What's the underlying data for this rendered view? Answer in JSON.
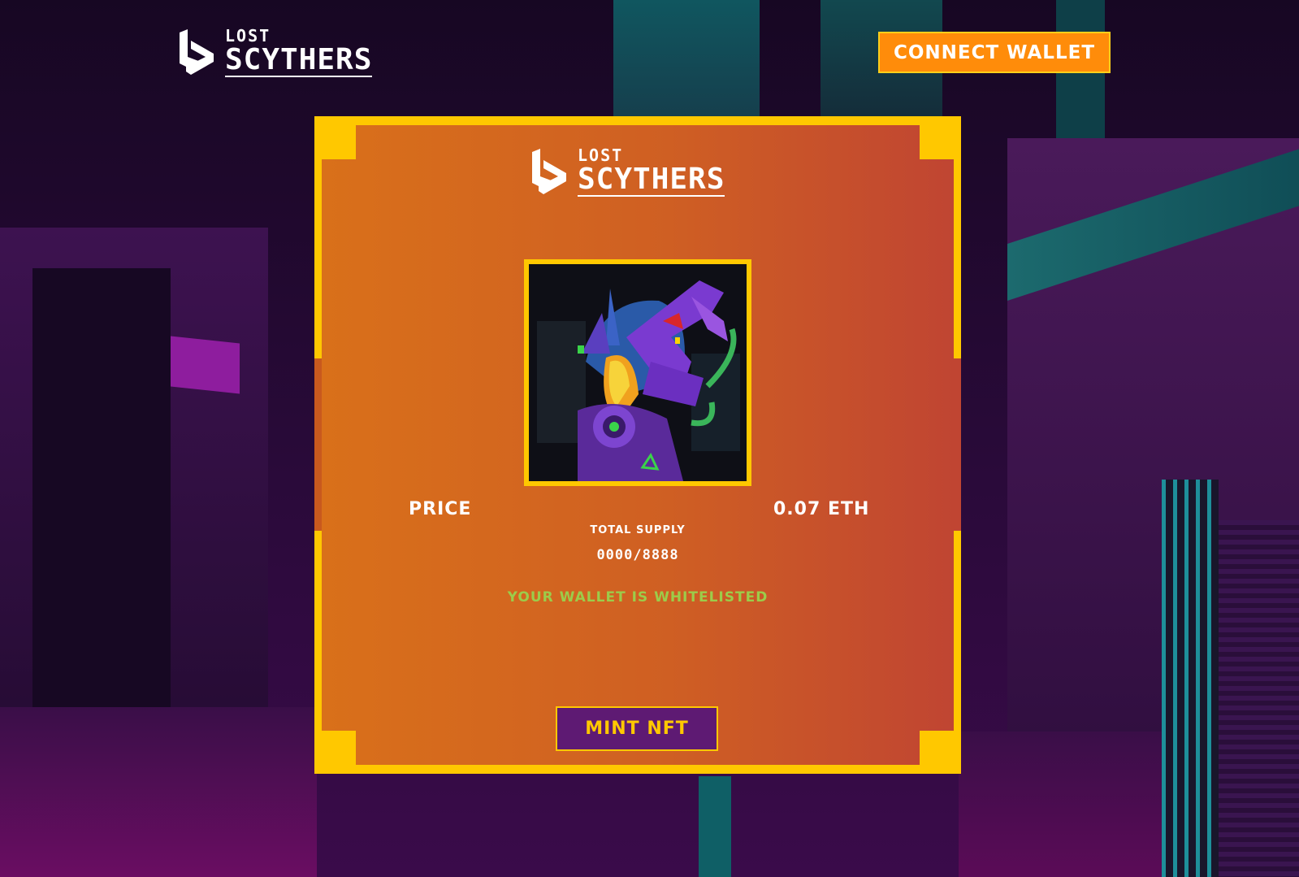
{
  "header": {
    "logo_top": "LOST",
    "logo_bottom": "SCYTHERS",
    "connect_label": "CONNECT WALLET"
  },
  "card": {
    "logo_top": "LOST",
    "logo_bottom": "SCYTHERS",
    "price_label": "PRICE",
    "price_value": "0.07 ETH",
    "supply_label": "TOTAL SUPPLY",
    "supply_value": "0000/8888",
    "whitelist_status": "YOUR WALLET IS WHITELISTED",
    "mint_label": "MINT NFT"
  },
  "colors": {
    "frame": "#ffc800",
    "connect_button": "#ff8c0a",
    "mint_button": "#5e1a73",
    "whitelist_text": "#9ccc4a"
  },
  "icons": {
    "brand": "lost-scythers-logo-mark",
    "nft": "robot-scyther-nft-artwork"
  }
}
